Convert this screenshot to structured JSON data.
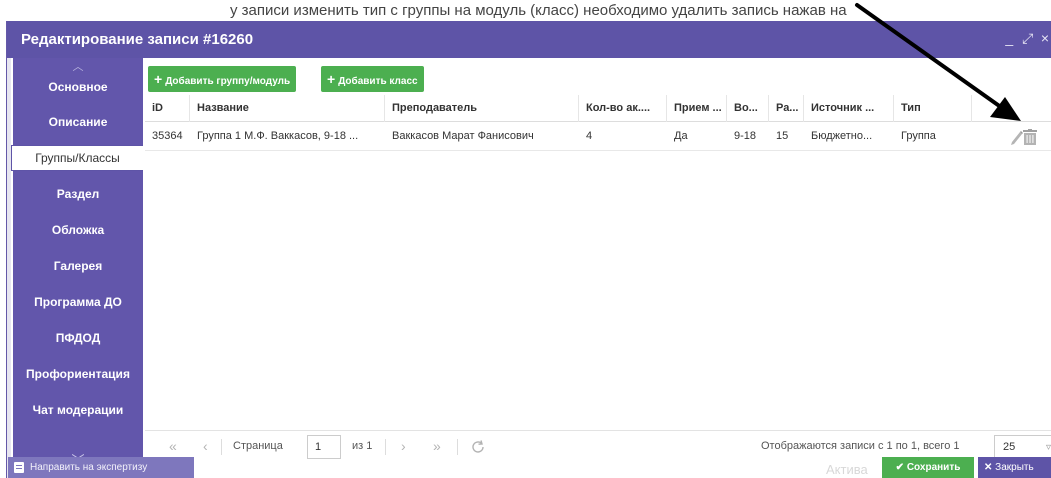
{
  "window": {
    "title": "Редактирование записи #16260",
    "controls": [
      "_",
      "⤢",
      "×"
    ]
  },
  "top_partial_text": "у записи изменить тип с группы на модуль (класс) необходимо удалить запись нажав на",
  "sidebar": {
    "items": [
      {
        "label": "Основное",
        "active": false
      },
      {
        "label": "Описание",
        "active": false
      },
      {
        "label": "Группы/Классы",
        "active": true
      },
      {
        "label": "Раздел",
        "active": false
      },
      {
        "label": "Обложка",
        "active": false
      },
      {
        "label": "Галерея",
        "active": false
      },
      {
        "label": "Программа ДО",
        "active": false
      },
      {
        "label": "ПФДОД",
        "active": false
      },
      {
        "label": "Профориентация",
        "active": false
      },
      {
        "label": "Чат модерации",
        "active": false
      }
    ]
  },
  "toolbar": {
    "add_group_label": "Добавить группу/модуль",
    "add_class_label": "Добавить класс"
  },
  "table": {
    "columns": [
      "iD",
      "Название",
      "Преподаватель",
      "Кол-во ак....",
      "Прием ...",
      "Во...",
      "Ра...",
      "Источник ...",
      "Тип"
    ],
    "rows": [
      [
        "35364",
        "Группа 1 М.Ф. Ваккасов, 9-18 ...",
        "Ваккасов Марат Фанисович",
        "4",
        "Да",
        "9-18",
        "15",
        "Бюджетно...",
        "Группа"
      ]
    ]
  },
  "pager": {
    "page_label": "Страница",
    "page_value": "1",
    "of_label": "из 1",
    "summary": "Отображаются записи с 1 по 1, всего 1",
    "page_size": "25"
  },
  "footer": {
    "expert_label": "Направить на экспертизу",
    "faded_text": "Актива",
    "save_label": "Сохранить",
    "close_label": "Закрыть"
  },
  "colors": {
    "accent": "#5e54a7",
    "green": "#4caf50"
  }
}
